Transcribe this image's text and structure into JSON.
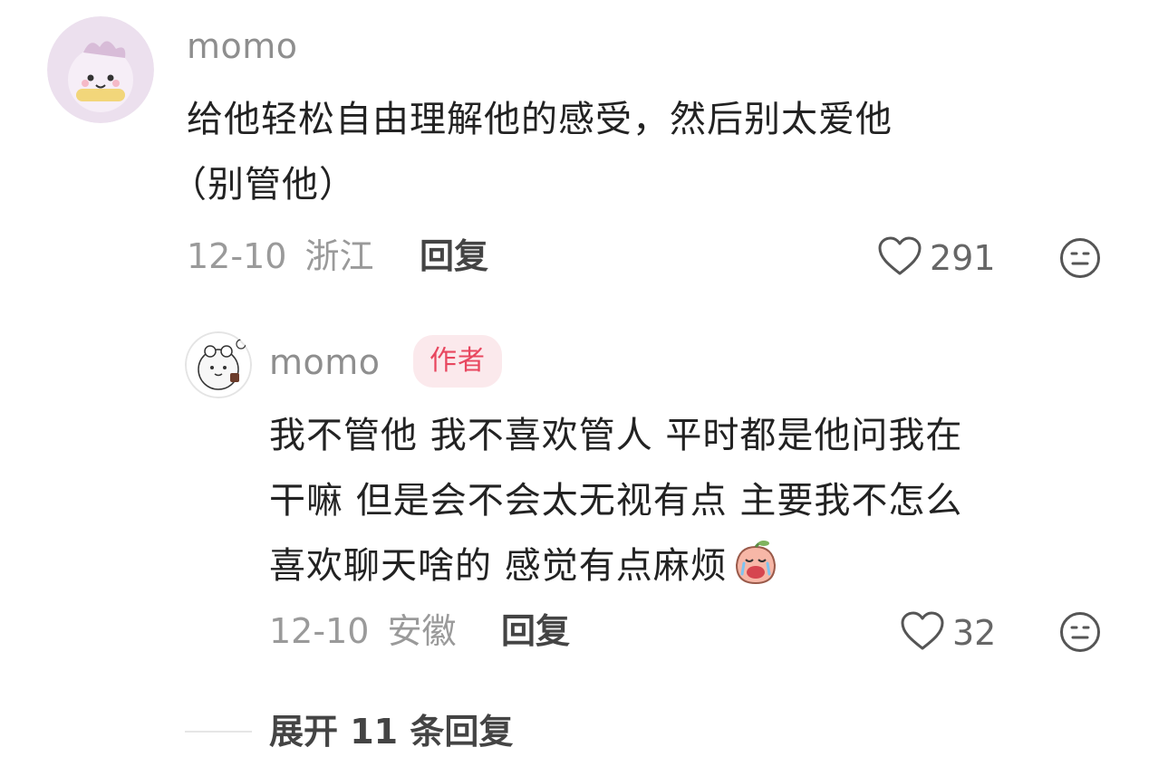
{
  "comment": {
    "username": "momo",
    "text_line1": "给他轻松自由理解他的感受，然后别太爱他",
    "text_line2": "（别管他）",
    "date": "12-10",
    "location": "浙江",
    "reply_label": "回复",
    "like_count": "291"
  },
  "reply": {
    "username": "momo",
    "badge": "作者",
    "text_line1": "我不管他 我不喜欢管人 平时都是他问我在",
    "text_line2": "干嘛 但是会不会太无视有点 主要我不怎么",
    "text_line3": "喜欢聊天啥的 感觉有点麻烦",
    "date": "12-10",
    "location": "安徽",
    "reply_label": "回复",
    "like_count": "32"
  },
  "expand": {
    "label": "展开 11 条回复"
  },
  "colors": {
    "badge_bg": "#fbe9ec",
    "badge_text": "#e8475f",
    "muted": "#9a9a9a"
  },
  "icons": {
    "like": "heart-outline-icon",
    "emoji": "face-icon"
  }
}
